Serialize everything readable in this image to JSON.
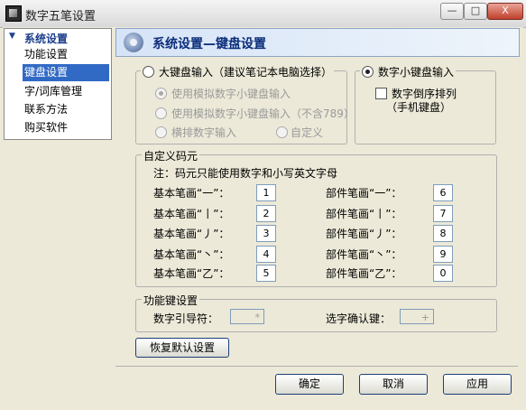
{
  "window": {
    "title": "数字五笔设置",
    "minimize": "—",
    "maximize": "□",
    "close": "X"
  },
  "sidebar": {
    "title": "系统设置",
    "items": [
      "功能设置",
      "键盘设置",
      "字/词库管理",
      "联系方法",
      "购买软件"
    ],
    "selected_index": 1
  },
  "panel": {
    "title": "系统设置—键盘设置"
  },
  "keyboard": {
    "big_radio": "大键盘输入（建议笔记本电脑选择）",
    "opt1": "使用模拟数字小键盘输入",
    "opt2": "使用模拟数字小键盘输入（不含789）",
    "opt3": "横排数字输入",
    "opt4": "自定义",
    "small_radio": "数字小键盘输入",
    "reverse": "数字倒序排列",
    "reverse_sub": "（手机键盘）"
  },
  "custom": {
    "label": "自定义码元",
    "note": "注：码元只能使用数字和小写英文字母",
    "basic": [
      {
        "label": "基本笔画“一”：",
        "value": "1"
      },
      {
        "label": "基本笔画“丨”：",
        "value": "2"
      },
      {
        "label": "基本笔画“丿”：",
        "value": "3"
      },
      {
        "label": "基本笔画“丶”：",
        "value": "4"
      },
      {
        "label": "基本笔画“乙”：",
        "value": "5"
      }
    ],
    "part": [
      {
        "label": "部件笔画“一”：",
        "value": "6"
      },
      {
        "label": "部件笔画“丨”：",
        "value": "7"
      },
      {
        "label": "部件笔画“丿”：",
        "value": "8"
      },
      {
        "label": "部件笔画“丶”：",
        "value": "9"
      },
      {
        "label": "部件笔画“乙”：",
        "value": "0"
      }
    ]
  },
  "hotkeys": {
    "label": "功能键设置",
    "num_lead_label": "数字引导符：",
    "num_lead_value": "*",
    "select_label": "选字确认键：",
    "select_value": "+"
  },
  "buttons": {
    "restore": "恢复默认设置",
    "ok": "确定",
    "cancel": "取消",
    "apply": "应用"
  }
}
